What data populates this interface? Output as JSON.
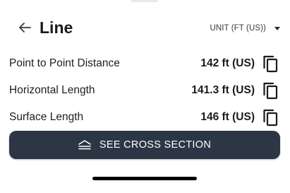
{
  "header": {
    "title": "Line",
    "back_icon": "arrow-left-icon",
    "unit_selector": {
      "selected": "UNIT (FT (US))",
      "icon": "caret-down-icon"
    }
  },
  "measurements": [
    {
      "label": "Point to Point Distance",
      "value": "142 ft (US)",
      "action_icon": "copy-icon"
    },
    {
      "label": "Horizontal Length",
      "value": "141.3 ft (US)",
      "action_icon": "copy-icon"
    },
    {
      "label": "Surface Length",
      "value": "146 ft (US)",
      "action_icon": "copy-icon"
    }
  ],
  "cta": {
    "label": "SEE CROSS SECTION",
    "icon": "cross-section-icon"
  },
  "colors": {
    "cta_background": "#2c3645",
    "cta_text": "#ffffff",
    "text_primary": "#1f1f1f",
    "home_indicator": "#000000"
  }
}
